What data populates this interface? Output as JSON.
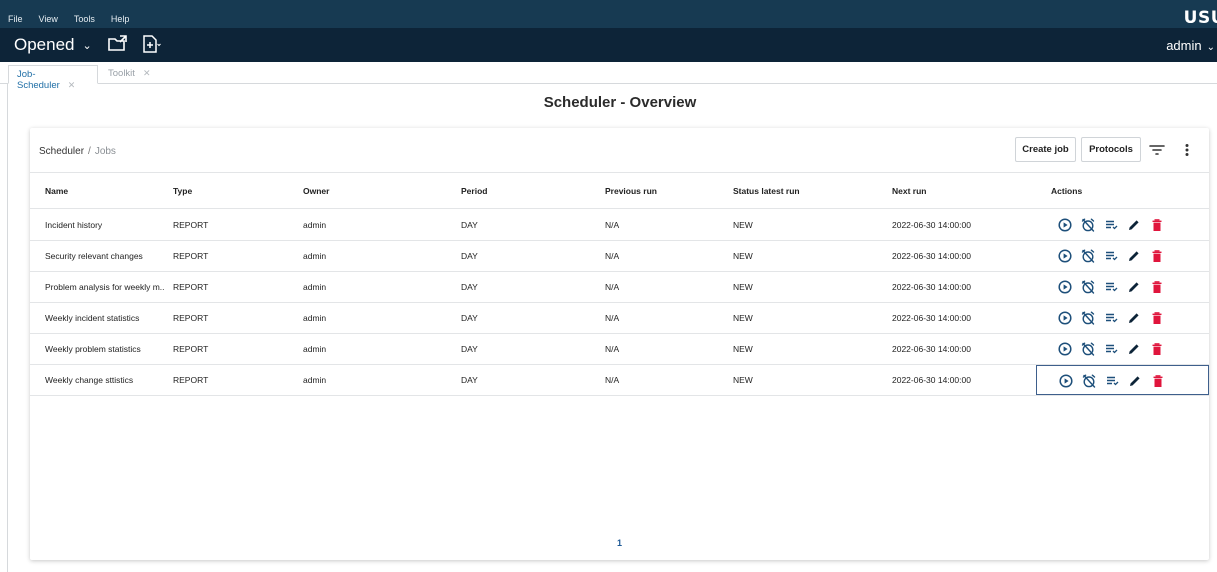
{
  "menubar": {
    "items": [
      "File",
      "View",
      "Tools",
      "Help"
    ],
    "brand": "USU"
  },
  "toolbar": {
    "opened_label": "Opened",
    "user": "admin"
  },
  "tabs": [
    {
      "label": "Job-Scheduler",
      "active": true
    },
    {
      "label": "Toolkit",
      "active": false
    }
  ],
  "page": {
    "title": "Scheduler - Overview"
  },
  "breadcrumb": {
    "root": "Scheduler",
    "current": "Jobs"
  },
  "buttons": {
    "create": "Create job",
    "protocols": "Protocols"
  },
  "table": {
    "headers": {
      "name": "Name",
      "type": "Type",
      "owner": "Owner",
      "period": "Period",
      "previous": "Previous run",
      "status": "Status latest run",
      "next": "Next run",
      "actions": "Actions"
    },
    "rows": [
      {
        "name": "Incident history",
        "type": "REPORT",
        "owner": "admin",
        "period": "DAY",
        "previous": "N/A",
        "status": "NEW",
        "next": "2022-06-30 14:00:00"
      },
      {
        "name": "Security relevant changes",
        "type": "REPORT",
        "owner": "admin",
        "period": "DAY",
        "previous": "N/A",
        "status": "NEW",
        "next": "2022-06-30 14:00:00"
      },
      {
        "name": "Problem analysis for weekly m...",
        "type": "REPORT",
        "owner": "admin",
        "period": "DAY",
        "previous": "N/A",
        "status": "NEW",
        "next": "2022-06-30 14:00:00"
      },
      {
        "name": "Weekly incident statistics",
        "type": "REPORT",
        "owner": "admin",
        "period": "DAY",
        "previous": "N/A",
        "status": "NEW",
        "next": "2022-06-30 14:00:00"
      },
      {
        "name": "Weekly problem statistics",
        "type": "REPORT",
        "owner": "admin",
        "period": "DAY",
        "previous": "N/A",
        "status": "NEW",
        "next": "2022-06-30 14:00:00"
      },
      {
        "name": "Weekly change sttistics",
        "type": "REPORT",
        "owner": "admin",
        "period": "DAY",
        "previous": "N/A",
        "status": "NEW",
        "next": "2022-06-30 14:00:00"
      }
    ],
    "action_icons": [
      "play-circle-icon",
      "alarm-off-icon",
      "list-icon",
      "pencil-icon",
      "trash-icon"
    ]
  },
  "pagination": {
    "current_page": "1"
  },
  "colors": {
    "menubar": "#173a52",
    "toolbar": "#0d2438",
    "accent": "#1f6ea6",
    "action_icon": "#1d4f7a",
    "delete_icon": "#e0153c"
  }
}
